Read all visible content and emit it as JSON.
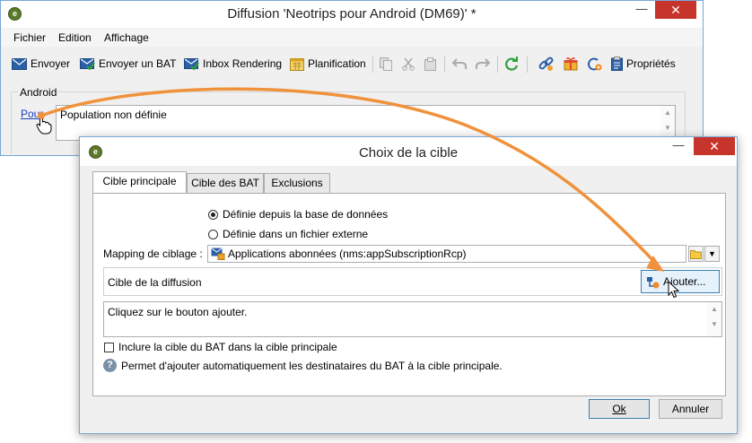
{
  "main": {
    "title": "Diffusion 'Neotrips pour Android (DM69)' *",
    "min_symbol": "—",
    "close_symbol": "✕",
    "menu": [
      "Fichier",
      "Edition",
      "Affichage"
    ],
    "toolbar": {
      "envoyer": "Envoyer",
      "envoyer_bat": "Envoyer un BAT",
      "inbox": "Inbox Rendering",
      "planification": "Planification",
      "proprietes": "Propriétés"
    },
    "group_label": "Android",
    "pour_link": "Pour",
    "population": "Population non définie"
  },
  "dialog": {
    "title": "Choix de la cible",
    "min_symbol": "—",
    "close_symbol": "✕",
    "tabs": [
      "Cible principale",
      "Cible des BAT",
      "Exclusions"
    ],
    "radio_db": "Définie depuis la base de données",
    "radio_file": "Définie dans un fichier externe",
    "mapping_label": "Mapping de ciblage :",
    "mapping_value": "Applications abonnées (nms:appSubscriptionRcp)",
    "cible_label": "Cible de la diffusion",
    "ajouter": "Ajouter...",
    "cible_placeholder": "Cliquez sur le bouton ajouter.",
    "include_bat": "Inclure la cible du BAT dans la cible principale",
    "help_text": "Permet d'ajouter automatiquement les destinataires du BAT à la cible principale.",
    "ok": "Ok",
    "annuler": "Annuler"
  },
  "colors": {
    "accent_orange": "#f0923c",
    "close_red": "#c7342b",
    "window_border": "#7aa7d6"
  }
}
